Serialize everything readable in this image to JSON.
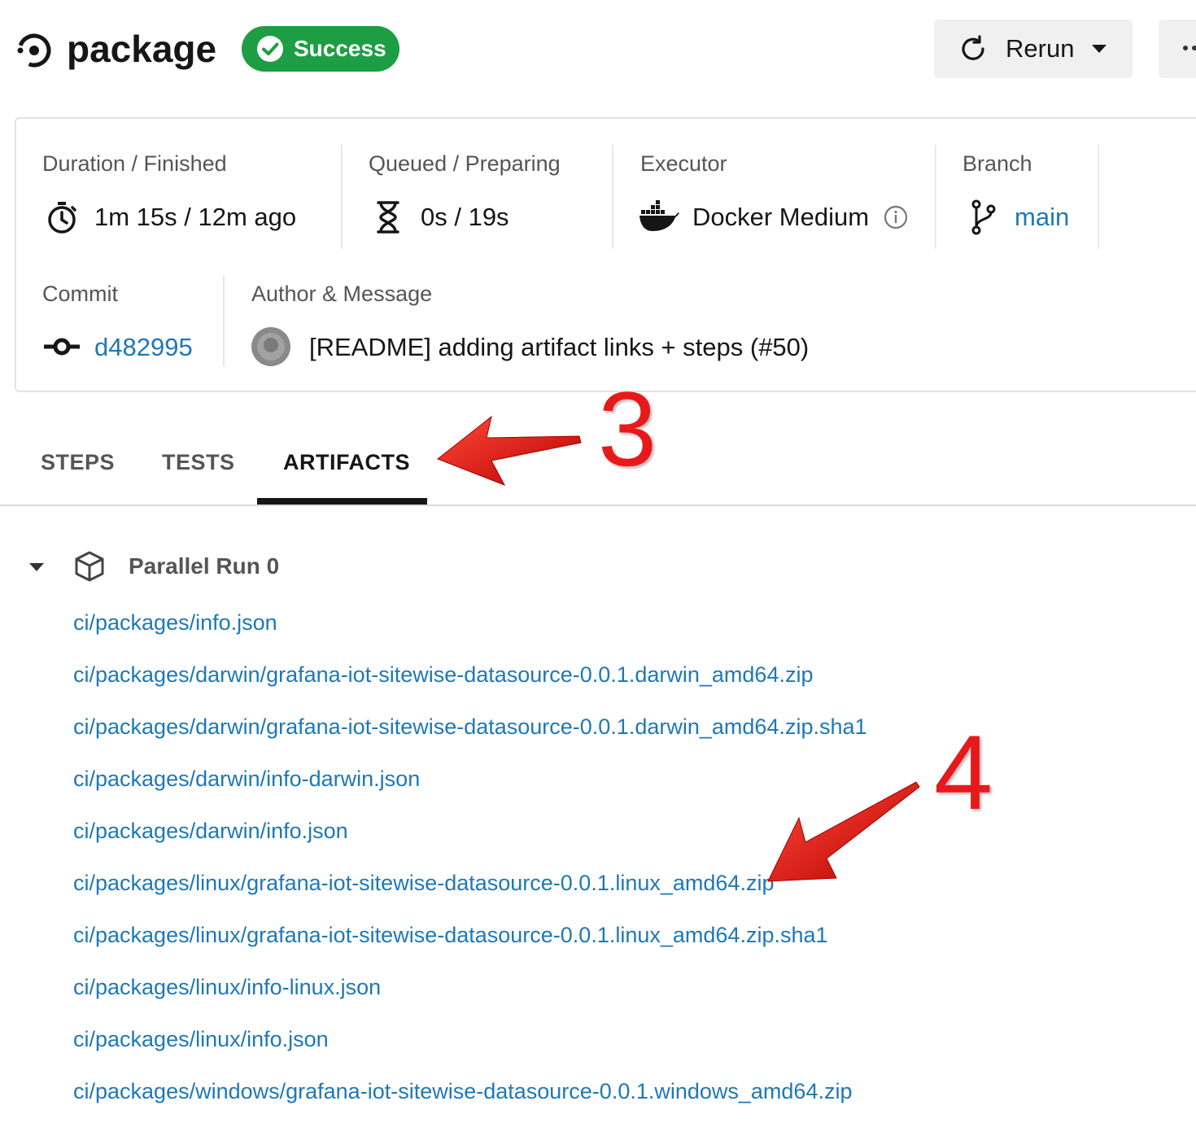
{
  "header": {
    "job_name": "package",
    "status_label": "Success",
    "status_color": "#1e9e44",
    "rerun_label": "Rerun"
  },
  "info": {
    "duration": {
      "label": "Duration / Finished",
      "value": "1m 15s / 12m ago",
      "icon": "stopwatch-icon"
    },
    "queued": {
      "label": "Queued / Preparing",
      "value": "0s / 19s",
      "icon": "hourglass-icon"
    },
    "executor": {
      "label": "Executor",
      "value": "Docker Medium",
      "icon": "docker-icon"
    },
    "branch": {
      "label": "Branch",
      "value": "main",
      "icon": "branch-icon"
    },
    "commit": {
      "label": "Commit",
      "value": "d482995",
      "icon": "commit-icon"
    },
    "author": {
      "label": "Author & Message",
      "message": "[README] adding artifact links + steps (#50)"
    }
  },
  "tabs": [
    {
      "label": "STEPS",
      "active": false
    },
    {
      "label": "TESTS",
      "active": false
    },
    {
      "label": "ARTIFACTS",
      "active": true
    }
  ],
  "artifacts": {
    "section_title": "Parallel Run 0",
    "items": [
      "ci/packages/info.json",
      "ci/packages/darwin/grafana-iot-sitewise-datasource-0.0.1.darwin_amd64.zip",
      "ci/packages/darwin/grafana-iot-sitewise-datasource-0.0.1.darwin_amd64.zip.sha1",
      "ci/packages/darwin/info-darwin.json",
      "ci/packages/darwin/info.json",
      "ci/packages/linux/grafana-iot-sitewise-datasource-0.0.1.linux_amd64.zip",
      "ci/packages/linux/grafana-iot-sitewise-datasource-0.0.1.linux_amd64.zip.sha1",
      "ci/packages/linux/info-linux.json",
      "ci/packages/linux/info.json",
      "ci/packages/windows/grafana-iot-sitewise-datasource-0.0.1.windows_amd64.zip"
    ]
  },
  "annotations": {
    "step3": "3",
    "step4": "4",
    "color": "#e8191b"
  },
  "colors": {
    "link": "#1e78b6",
    "text": "#161616",
    "muted": "#555555"
  }
}
